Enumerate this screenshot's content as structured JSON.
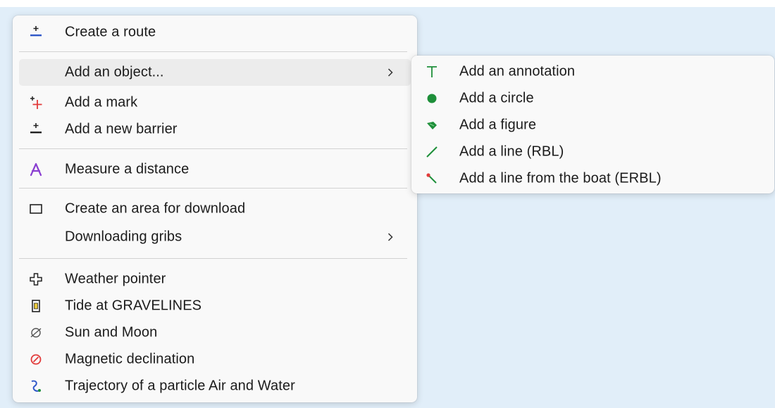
{
  "main_menu": {
    "items": [
      {
        "label": "Create a route",
        "icon": "route-icon"
      },
      {
        "label": "Add an object...",
        "icon": "none",
        "submenu": true
      },
      {
        "label": "Add a mark",
        "icon": "add-mark-icon"
      },
      {
        "label": "Add a new barrier",
        "icon": "barrier-icon"
      },
      {
        "label": "Measure a distance",
        "icon": "compass-icon"
      },
      {
        "label": "Create an area for download",
        "icon": "rectangle-icon"
      },
      {
        "label": "Downloading gribs",
        "icon": "none",
        "submenu": true
      },
      {
        "label": "Weather pointer",
        "icon": "weather-pointer-icon"
      },
      {
        "label": "Tide at GRAVELINES",
        "icon": "tide-icon"
      },
      {
        "label": "Sun and Moon",
        "icon": "sun-moon-icon"
      },
      {
        "label": "Magnetic declination",
        "icon": "magnetic-icon"
      },
      {
        "label": "Trajectory of a particle Air and Water",
        "icon": "trajectory-icon"
      }
    ]
  },
  "sub_menu": {
    "items": [
      {
        "label": "Add an annotation",
        "icon": "annotation-icon"
      },
      {
        "label": "Add a circle",
        "icon": "circle-icon"
      },
      {
        "label": "Add a figure",
        "icon": "figure-icon"
      },
      {
        "label": "Add a line (RBL)",
        "icon": "line-icon"
      },
      {
        "label": "Add a line from the boat (ERBL)",
        "icon": "boat-line-icon"
      }
    ]
  },
  "colors": {
    "map_background": "#e1eef9",
    "menu_background": "#f9f9f9",
    "hover_background": "#ececec",
    "green_icon": "#1e8f3a",
    "blue_icon": "#2f58c8",
    "red_icon": "#e23b3b",
    "purple_icon": "#8a3fd1"
  }
}
